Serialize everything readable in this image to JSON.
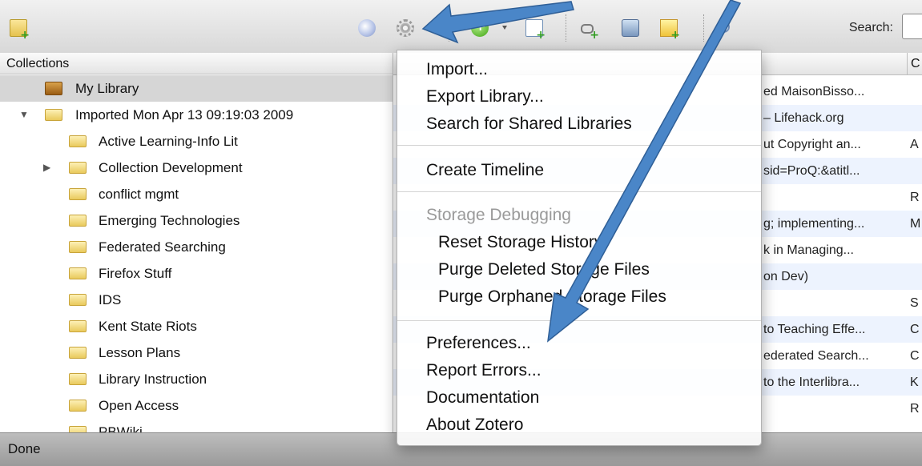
{
  "toolbar": {
    "search_label": "Search:",
    "search_value": ""
  },
  "collections": {
    "header": "Collections",
    "items": [
      {
        "label": "My Library"
      },
      {
        "label": "Imported Mon Apr 13 09:19:03 2009"
      },
      {
        "label": "Active Learning-Info Lit"
      },
      {
        "label": "Collection Development"
      },
      {
        "label": "conflict mgmt"
      },
      {
        "label": "Emerging Technologies"
      },
      {
        "label": "Federated Searching"
      },
      {
        "label": "Firefox Stuff"
      },
      {
        "label": "IDS"
      },
      {
        "label": "Kent State Riots"
      },
      {
        "label": "Lesson Plans"
      },
      {
        "label": "Library Instruction"
      },
      {
        "label": "Open Access"
      },
      {
        "label": "PBWiki"
      }
    ]
  },
  "items": {
    "header_col2": "C",
    "rows": [
      {
        "title": "ed MaisonBisso...",
        "creator": ""
      },
      {
        "title": "– Lifehack.org",
        "creator": ""
      },
      {
        "title": "ut Copyright an...",
        "creator": "A"
      },
      {
        "title": "sid=ProQ:&atitl...",
        "creator": ""
      },
      {
        "title": "",
        "creator": "R"
      },
      {
        "title": "g; implementing...",
        "creator": "M"
      },
      {
        "title": "k in Managing...",
        "creator": ""
      },
      {
        "title": "on Dev)",
        "creator": ""
      },
      {
        "title": "",
        "creator": "S"
      },
      {
        "title": "to Teaching Effe...",
        "creator": "C"
      },
      {
        "title": "ederated Search...",
        "creator": "C"
      },
      {
        "title": "to the Interlibra...",
        "creator": "K"
      },
      {
        "title": "",
        "creator": "R"
      }
    ]
  },
  "menu": {
    "import": "Import...",
    "export_library": "Export Library...",
    "search_shared": "Search for Shared Libraries",
    "create_timeline": "Create Timeline",
    "storage_debugging": "Storage Debugging",
    "reset_storage_history": "Reset Storage History",
    "purge_deleted": "Purge Deleted Storage Files",
    "purge_orphaned": "Purge Orphaned Storage Files",
    "preferences": "Preferences...",
    "report_errors": "Report Errors...",
    "documentation": "Documentation",
    "about": "About Zotero"
  },
  "status": {
    "text": "Done"
  },
  "colors": {
    "arrow": "#4a86c8",
    "selection": "#d6d6d6",
    "alt_row": "#edf3fe"
  }
}
